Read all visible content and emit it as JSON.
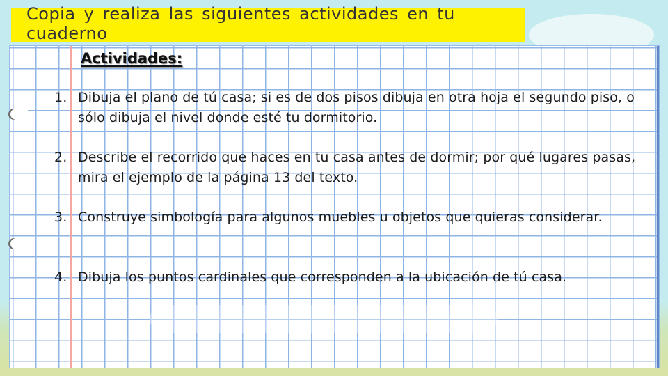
{
  "header": {
    "instruction": "Copia y realiza las siguientes actividades en tu cuaderno"
  },
  "content": {
    "heading": "Actividades:",
    "activities": [
      {
        "number": "1.",
        "text": "Dibuja el plano de tú casa; si es de dos pisos dibuja en otra hoja el segundo piso, o sólo dibuja el nivel donde esté tu dormitorio."
      },
      {
        "number": "2.",
        "text": "Describe el recorrido que haces en tu casa antes de dormir; por qué lugares pasas, mira el ejemplo de la página 13 del texto."
      },
      {
        "number": "3.",
        "text": "Construye simbología para algunos muebles u objetos que quieras considerar."
      },
      {
        "number": "4.",
        "text": "Dibuja los puntos cardinales que corresponden a la ubicación de tú casa."
      }
    ]
  },
  "colors": {
    "highlight": "#fff200",
    "grid_line": "#8fb4e6",
    "margin_line": "#f3a7a0",
    "background": "#c4ecf0"
  }
}
